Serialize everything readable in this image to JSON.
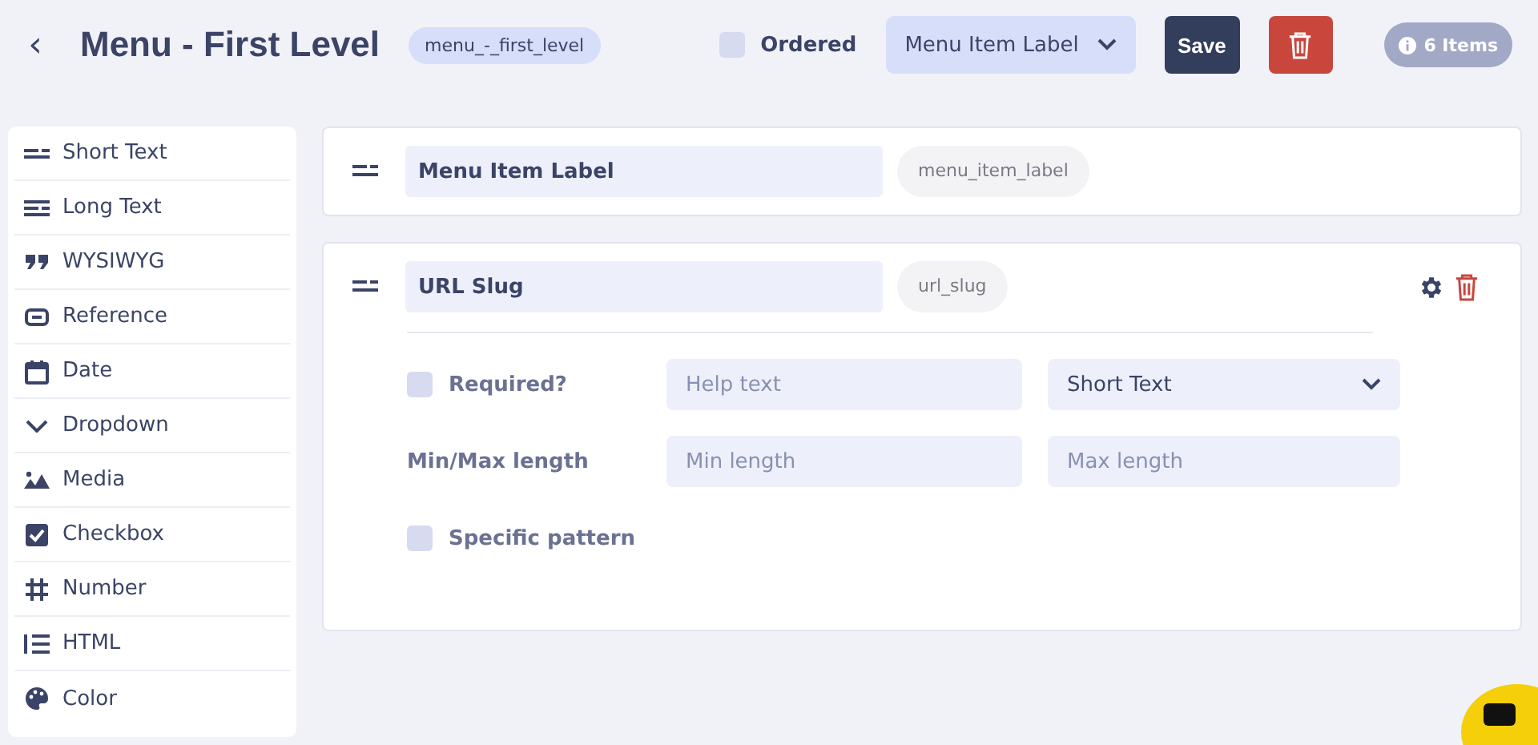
{
  "header": {
    "back": "‹",
    "title": "Menu - First Level",
    "slug": "menu_-_first_level",
    "ordered": {
      "label": "Ordered",
      "checked": false
    },
    "sort_select": "Menu Item Label",
    "save": "Save",
    "count": "6 Items"
  },
  "sidebar": {
    "items": [
      {
        "kind": "short",
        "label": "Short Text"
      },
      {
        "kind": "long",
        "label": "Long Text"
      },
      {
        "kind": "quote",
        "label": "WYSIWYG"
      },
      {
        "kind": "link",
        "label": "Reference"
      },
      {
        "kind": "date",
        "label": "Date"
      },
      {
        "kind": "chevron",
        "label": "Dropdown"
      },
      {
        "kind": "media",
        "label": "Media"
      },
      {
        "kind": "checkbox",
        "label": "Checkbox"
      },
      {
        "kind": "hash",
        "label": "Number"
      },
      {
        "kind": "list",
        "label": "HTML"
      },
      {
        "kind": "palette",
        "label": "Color"
      }
    ]
  },
  "fields": [
    {
      "label": "Menu Item Label",
      "key": "menu_item_label"
    },
    {
      "label": "URL Slug",
      "key": "url_slug",
      "settings": {
        "required": {
          "label": "Required?",
          "checked": false
        },
        "help_placeholder": "Help text",
        "type": "Short Text",
        "length_label": "Min/Max length",
        "min_placeholder": "Min length",
        "max_placeholder": "Max length",
        "pattern": {
          "label": "Specific pattern",
          "checked": false
        }
      }
    }
  ]
}
